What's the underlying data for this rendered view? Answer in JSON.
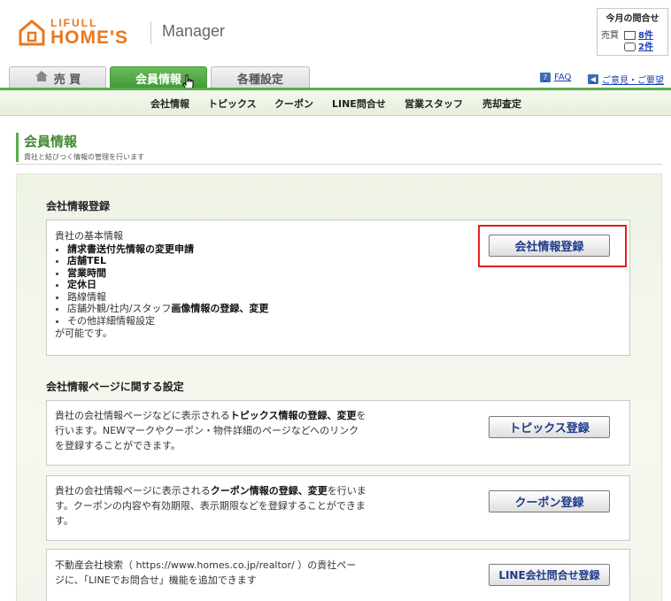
{
  "header": {
    "logo_small": "LIFULL",
    "logo_big": "HOME'S",
    "product": "Manager"
  },
  "inquiries": {
    "title": "今月の問合せ",
    "label": "売買",
    "mail_count": "8件",
    "tel_count": "2件"
  },
  "tabs": [
    {
      "label": "売 買"
    },
    {
      "label": "会員情報"
    },
    {
      "label": "各種設定"
    }
  ],
  "links": {
    "faq": "FAQ",
    "feedback": "ご意見・ご要望"
  },
  "subnav": [
    "会社情報",
    "トピックス",
    "クーポン",
    "LINE問合せ",
    "営業スタッフ",
    "売却査定"
  ],
  "page": {
    "title": "会員情報",
    "subtitle": "貴社と結びつく情報の管理を行います"
  },
  "section1": {
    "title": "会社情報登録",
    "intro": "貴社の基本情報",
    "items": [
      {
        "text": "請求書送付先情報の変更申請",
        "bold": true
      },
      {
        "text": "店舗TEL",
        "bold": true
      },
      {
        "text": "営業時間",
        "bold": true
      },
      {
        "text": "定休日",
        "bold": true
      },
      {
        "text": "路線情報",
        "bold": false
      },
      {
        "pre": "店舗外観/社内/スタッフ",
        "bold_part": "画像情報の登録、変更"
      },
      {
        "text": "その他詳細情報設定",
        "bold": false
      }
    ],
    "outro": "が可能です。",
    "button": "会社情報登録"
  },
  "section2": {
    "title": "会社情報ページに関する設定",
    "topics": {
      "t1": "貴社の会社情報ページなどに表示される",
      "t1b": "トピックス情報の登録、変更",
      "t1c": "を",
      "t2": "行います。NEWマークやクーポン・物件詳細のページなどへのリンク",
      "t3": "を登録することができます。",
      "button": "トピックス登録"
    },
    "coupon": {
      "t1": "貴社の会社情報ページに表示される",
      "t1b": "クーポン情報の登録、変更",
      "t1c": "を行いま",
      "t2": "す。クーポンの内容や有効期限、表示期限などを登録することができま",
      "t3": "す。",
      "button": "クーポン登録"
    },
    "line": {
      "t1": "不動産会社検索（ https://www.homes.co.jp/realtor/ ）の貴社ペー",
      "t2": "ジに、「LINEでお問合せ」機能を追加できます",
      "button": "LINE会社問合せ登録"
    }
  }
}
